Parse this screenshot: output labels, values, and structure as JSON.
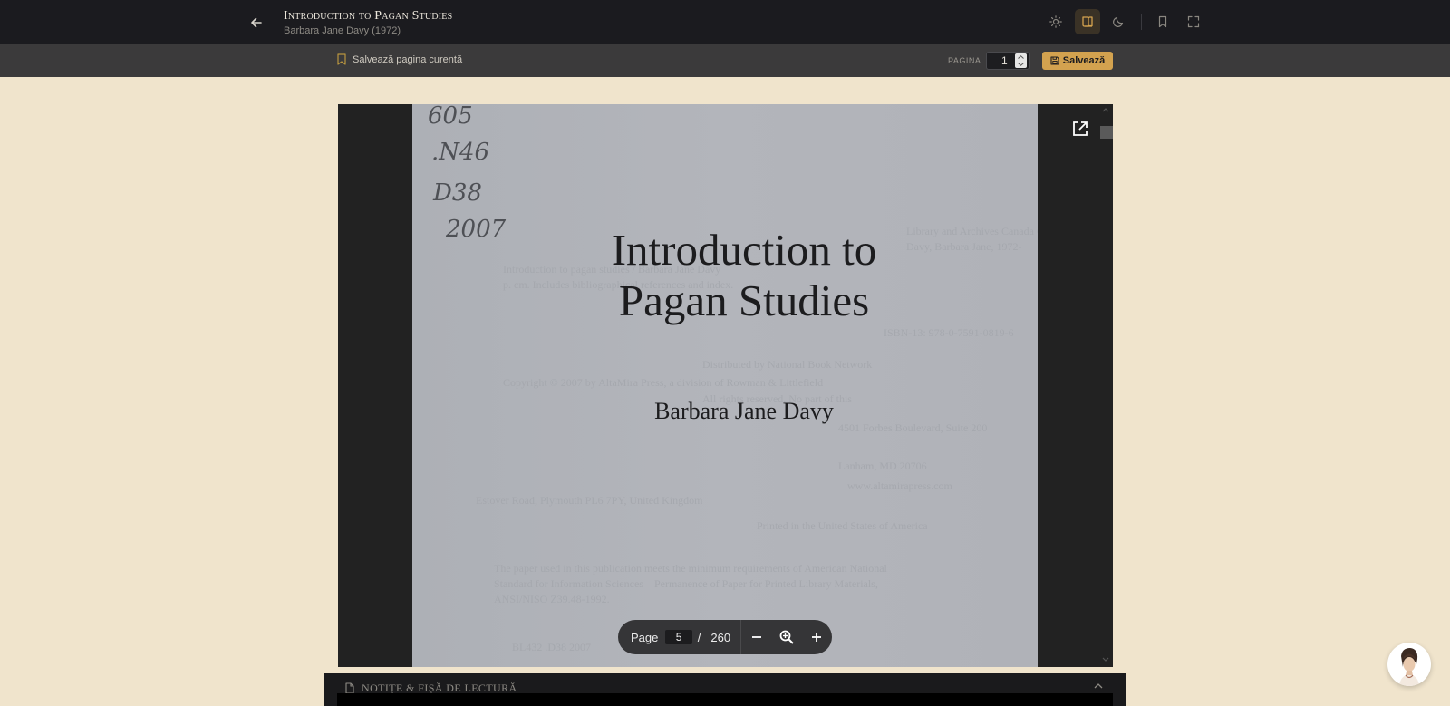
{
  "header": {
    "title": "Introduction to Pagan Studies",
    "subtitle": "Barbara Jane Davy (1972)",
    "icons": [
      "arrow-left-icon",
      "sun-icon",
      "book-open-icon",
      "moon-icon",
      "bookmark-icon",
      "fullscreen-icon"
    ],
    "active_theme": "book-open-icon"
  },
  "subbar": {
    "save_current_page": "Salvează pagina curentă",
    "page_label": "PAGINA",
    "page_value": "1",
    "save_button": "Salvează"
  },
  "pdf": {
    "handwriting": [
      "605",
      ".N46",
      "D38",
      "2007"
    ],
    "title_line1": "Introduction to",
    "title_line2": "Pagan Studies",
    "author": "Barbara Jane Davy",
    "toolbar": {
      "page_label": "Page",
      "current_page": "5",
      "separator": "/",
      "total_pages": "260"
    }
  },
  "notes": {
    "label": "NOTIȚE & FIȘĂ DE LECTURĂ"
  },
  "colors": {
    "accent": "#d3a24f",
    "background": "#f0e4cc",
    "header": "#1b1b1f"
  }
}
